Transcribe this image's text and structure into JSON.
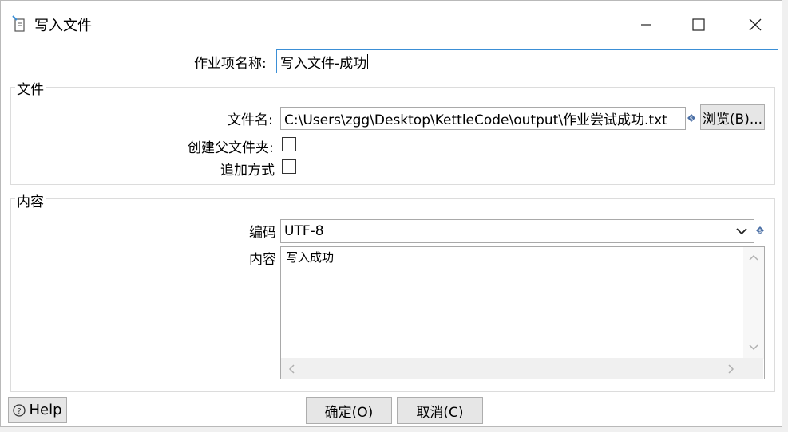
{
  "window": {
    "title": "写入文件",
    "icon": "file-write-icon"
  },
  "job_name": {
    "label": "作业项名称:",
    "value": "写入文件-成功"
  },
  "file_group": {
    "title": "文件",
    "filename_label": "文件名:",
    "filename_value": "C:\\Users\\zgg\\Desktop\\KettleCode\\output\\作业尝试成功.txt",
    "browse_button": "浏览(B)...",
    "create_parent_label": "创建父文件夹:",
    "append_label": "追加方式"
  },
  "content_group": {
    "title": "内容",
    "encoding_label": "编码",
    "encoding_value": "UTF-8",
    "content_label": "内容",
    "content_value": "写入成功"
  },
  "footer": {
    "help": "Help",
    "ok": "确定(O)",
    "cancel": "取消(C)"
  },
  "colors": {
    "accent": "#3b8fd6",
    "variable_icon": "#4a6fa5"
  }
}
